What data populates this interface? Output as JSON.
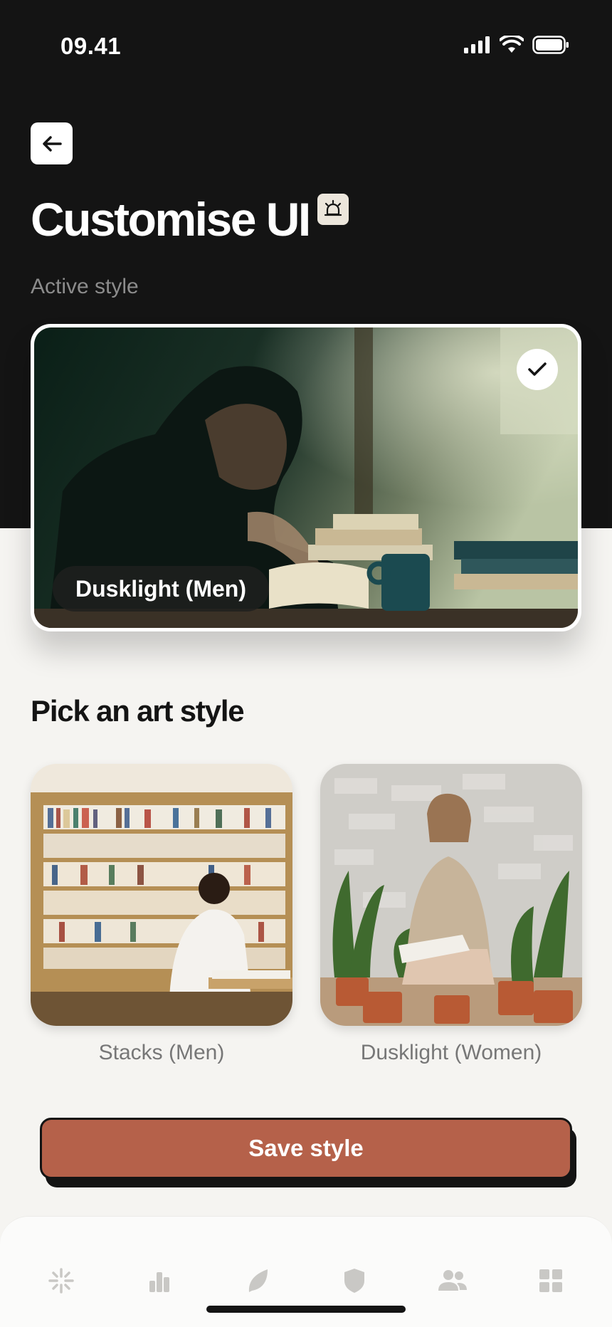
{
  "status_bar": {
    "time": "09.41"
  },
  "header": {
    "back_icon": "arrow-left-icon",
    "title": "Customise UI",
    "badge_icon": "alarm-icon"
  },
  "active_section": {
    "label": "Active style",
    "selected_style": "Dusklight (Men)",
    "check_icon": "checkmark-icon"
  },
  "picker": {
    "heading": "Pick an art style",
    "options": [
      {
        "label": "Stacks (Men)"
      },
      {
        "label": "Dusklight (Women)"
      }
    ]
  },
  "save_button": {
    "label": "Save style"
  },
  "bottom_nav": {
    "items": [
      {
        "icon": "sparkle-icon"
      },
      {
        "icon": "bar-chart-icon"
      },
      {
        "icon": "leaf-icon"
      },
      {
        "icon": "shield-icon"
      },
      {
        "icon": "users-icon"
      },
      {
        "icon": "grid-icon"
      }
    ]
  },
  "colors": {
    "dark_bg": "#141414",
    "page_bg": "#f5f4f1",
    "accent": "#b5614a",
    "nav_icon": "#c9c8c5"
  }
}
